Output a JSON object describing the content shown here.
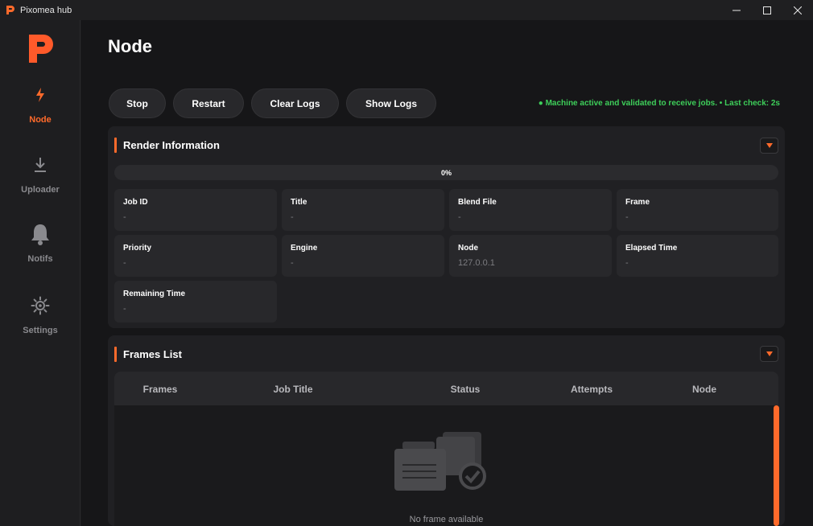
{
  "app": {
    "title": "Pixomea hub"
  },
  "sidebar": {
    "items": [
      {
        "label": "Node",
        "icon": "bolt-icon",
        "active": true
      },
      {
        "label": "Uploader",
        "icon": "download-icon",
        "active": false
      },
      {
        "label": "Notifs",
        "icon": "bell-icon",
        "active": false
      },
      {
        "label": "Settings",
        "icon": "gear-icon",
        "active": false
      }
    ]
  },
  "page": {
    "title": "Node"
  },
  "actions": {
    "stop": "Stop",
    "restart": "Restart",
    "clear_logs": "Clear Logs",
    "show_logs": "Show Logs"
  },
  "status": {
    "message": "● Machine active and validated to receive jobs.  •  Last check: 2s"
  },
  "render_info": {
    "title": "Render Information",
    "progress": "0%",
    "fields": [
      {
        "label": "Job ID",
        "value": "-"
      },
      {
        "label": "Title",
        "value": "-"
      },
      {
        "label": "Blend File",
        "value": "-"
      },
      {
        "label": "Frame",
        "value": "-"
      },
      {
        "label": "Priority",
        "value": "-"
      },
      {
        "label": "Engine",
        "value": "-"
      },
      {
        "label": "Node",
        "value": "127.0.0.1"
      },
      {
        "label": "Elapsed Time",
        "value": "-"
      },
      {
        "label": "Remaining Time",
        "value": "-"
      }
    ]
  },
  "frames_list": {
    "title": "Frames List",
    "columns": [
      "Frames",
      "Job Title",
      "Status",
      "Attempts",
      "Node"
    ],
    "empty_message": "No frame available"
  },
  "colors": {
    "accent": "#ff6a2b",
    "status_ok": "#3ecf5a",
    "background": "#161618"
  }
}
